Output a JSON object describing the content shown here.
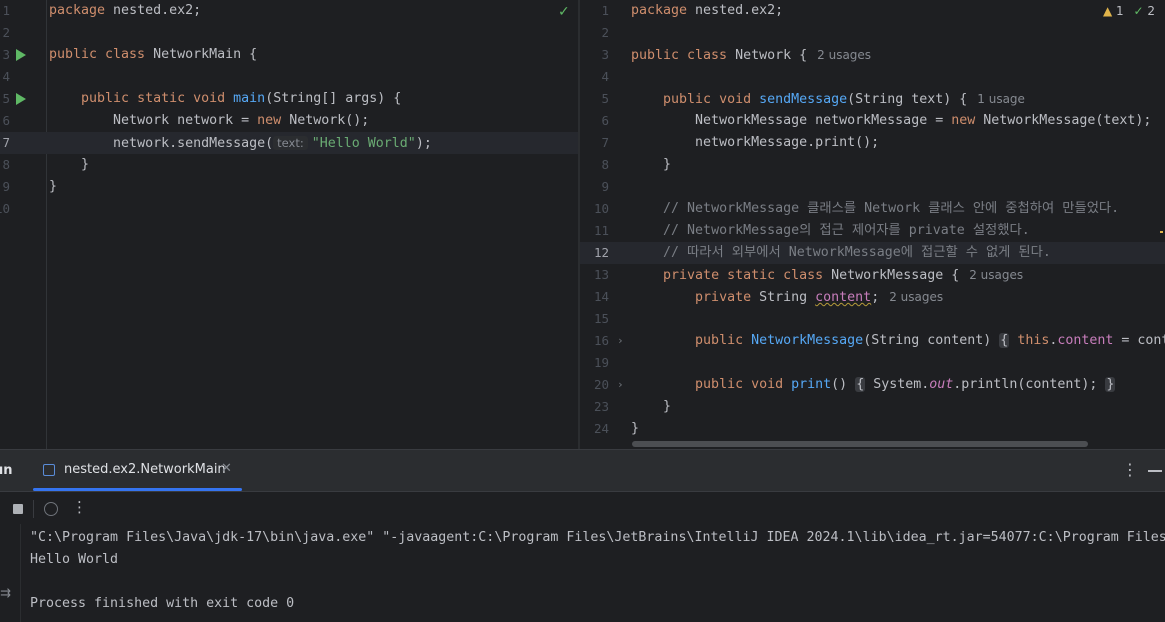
{
  "left_editor": {
    "lines": [
      {
        "n": "1",
        "kw": "package",
        "rest": " nested.ex2;"
      },
      {
        "n": "2"
      },
      {
        "n": "3",
        "kw": "public class",
        "rest": " NetworkMain {"
      },
      {
        "n": "4"
      },
      {
        "n": "5",
        "indent": "    ",
        "kw": "public static void",
        "fn": "main",
        "rest": "(String[] args) {"
      },
      {
        "n": "6",
        "indent": "        ",
        "pre": "Network network = ",
        "kw": "new",
        "rest": " Network();"
      },
      {
        "n": "7",
        "indent": "        ",
        "pre": "network.sendMessage(",
        "hint": "text:",
        "str": "\"Hello World\"",
        "rest": ");"
      },
      {
        "n": "8",
        "indent": "    ",
        "pre": "}"
      },
      {
        "n": "9",
        "pre": "}"
      },
      {
        "n": "10"
      }
    ]
  },
  "right_editor": {
    "inspections": {
      "warnings": "1",
      "weak": "2"
    },
    "lines": [
      {
        "n": "1",
        "kw": "package",
        "rest": " nested.ex2;"
      },
      {
        "n": "2"
      },
      {
        "n": "3",
        "kw": "public class",
        "rest": " Network {",
        "usage": "2 usages"
      },
      {
        "n": "4"
      },
      {
        "n": "5",
        "indent": "    ",
        "kw": "public void",
        "fn": "sendMessage",
        "rest": "(String text) {",
        "usage": "1 usage"
      },
      {
        "n": "6",
        "indent": "        ",
        "pre": "NetworkMessage networkMessage = ",
        "kw": "new",
        "rest": " NetworkMessage(text);"
      },
      {
        "n": "7",
        "indent": "        ",
        "pre": "networkMessage.print();"
      },
      {
        "n": "8",
        "indent": "    ",
        "pre": "}"
      },
      {
        "n": "9"
      },
      {
        "n": "10",
        "indent": "    ",
        "comment": "// NetworkMessage 클래스를 Network 클래스 안에 중첩하여 만들었다."
      },
      {
        "n": "11",
        "indent": "    ",
        "comment": "// NetworkMessage의 접근 제어자를 private 설정했다."
      },
      {
        "n": "12",
        "indent": "    ",
        "comment": "// 따라서 외부에서 NetworkMessage에 접근할 수 없게 된다."
      },
      {
        "n": "13",
        "indent": "    ",
        "kw": "private static class",
        "rest": " NetworkMessage {",
        "usage": "2 usages"
      },
      {
        "n": "14",
        "indent": "        ",
        "kw": "private",
        "rest": " String ",
        "field": "content",
        "tail": ";",
        "usage": "2 usages"
      },
      {
        "n": "15"
      },
      {
        "n": "16",
        "indent": "        ",
        "kw": "public",
        "fn": "NetworkMessage",
        "rest": "(String content) ",
        "brace": "{",
        "kw2": "this",
        "tail2": ".",
        "field": "content",
        "tail": " = cont"
      },
      {
        "n": "19"
      },
      {
        "n": "20",
        "indent": "        ",
        "kw": "public void",
        "fn": "print",
        "rest": "() ",
        "brace": "{",
        "pre2": " System.",
        "static_field": "out",
        "tail": ".println(content); ",
        "brace_end": "}"
      },
      {
        "n": "23",
        "indent": "    ",
        "pre": "}"
      },
      {
        "n": "24",
        "pre": "}"
      }
    ]
  },
  "run_panel": {
    "label": "un",
    "tab_title": "nested.ex2.NetworkMain",
    "console": [
      "\"C:\\Program Files\\Java\\jdk-17\\bin\\java.exe\" \"-javaagent:C:\\Program Files\\JetBrains\\IntelliJ IDEA 2024.1\\lib\\idea_rt.jar=54077:C:\\Program Files",
      "Hello World",
      "",
      "Process finished with exit code 0"
    ]
  }
}
